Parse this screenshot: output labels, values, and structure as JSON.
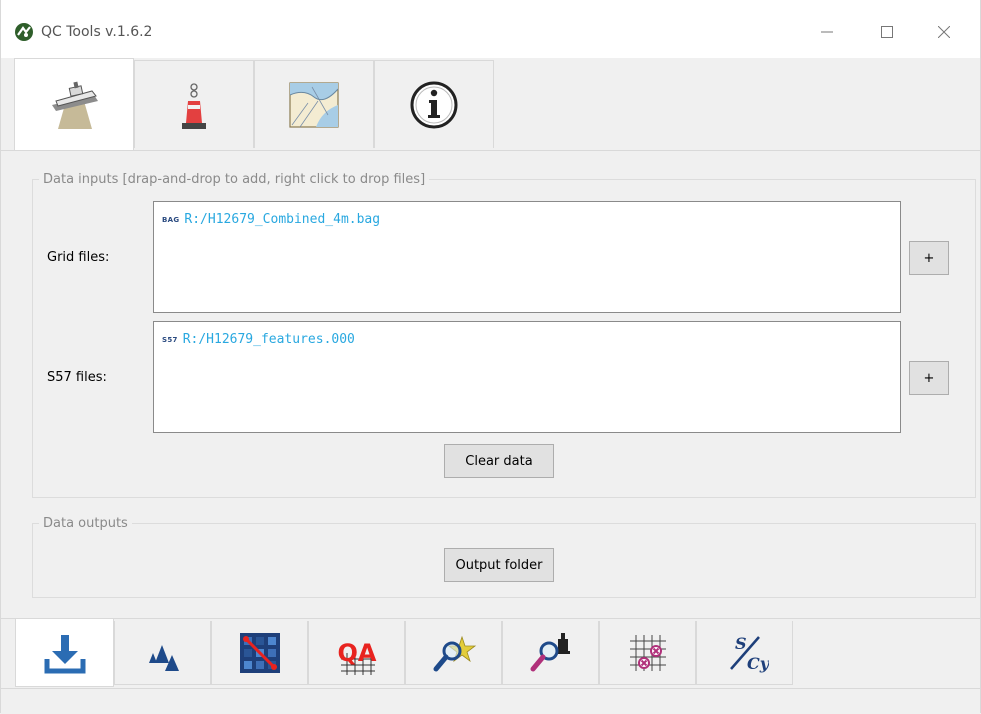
{
  "window": {
    "title": "QC Tools v.1.6.2",
    "app_icon": "qctools-logo-icon",
    "controls": {
      "minimize": "minimize-icon",
      "maximize": "maximize-icon",
      "close": "close-icon"
    }
  },
  "top_tabs": [
    {
      "icon": "survey-vessel-icon",
      "active": true
    },
    {
      "icon": "buoy-icon",
      "active": false
    },
    {
      "icon": "nautical-chart-icon",
      "active": false
    },
    {
      "icon": "info-icon",
      "active": false
    }
  ],
  "data_inputs": {
    "legend": "Data inputs  [drap-and-drop to add, right click to drop files]",
    "grid": {
      "label": "Grid files:",
      "files": [
        {
          "tag": "BAG",
          "path": "R:/H12679_Combined_4m.bag"
        }
      ],
      "add_label": "+"
    },
    "s57": {
      "label": "S57 files:",
      "files": [
        {
          "tag": "S57",
          "path": "R:/H12679_features.000"
        }
      ],
      "add_label": "+"
    },
    "clear_label": "Clear data"
  },
  "data_outputs": {
    "legend": "Data outputs",
    "output_folder_label": "Output folder"
  },
  "bottom_tabs": [
    {
      "icon": "download-icon",
      "active": true
    },
    {
      "icon": "surface-peaks-icon",
      "active": false
    },
    {
      "icon": "grid-qa-icon",
      "active": false
    },
    {
      "icon": "qa-grid-icon",
      "active": false,
      "text": "QA"
    },
    {
      "icon": "feature-scan-icon",
      "active": false
    },
    {
      "icon": "designated-soundings-icon",
      "active": false
    },
    {
      "icon": "valsou-check-icon",
      "active": false
    },
    {
      "icon": "sounding-cy-icon",
      "active": false,
      "text_top": "S",
      "text_bottom": "Cy"
    }
  ],
  "colors": {
    "file_path": "#29a8e0",
    "file_tag": "#2a4a80",
    "download_blue": "#2b6cb3",
    "qa_red": "#e8231f",
    "magenta": "#b0307a"
  }
}
